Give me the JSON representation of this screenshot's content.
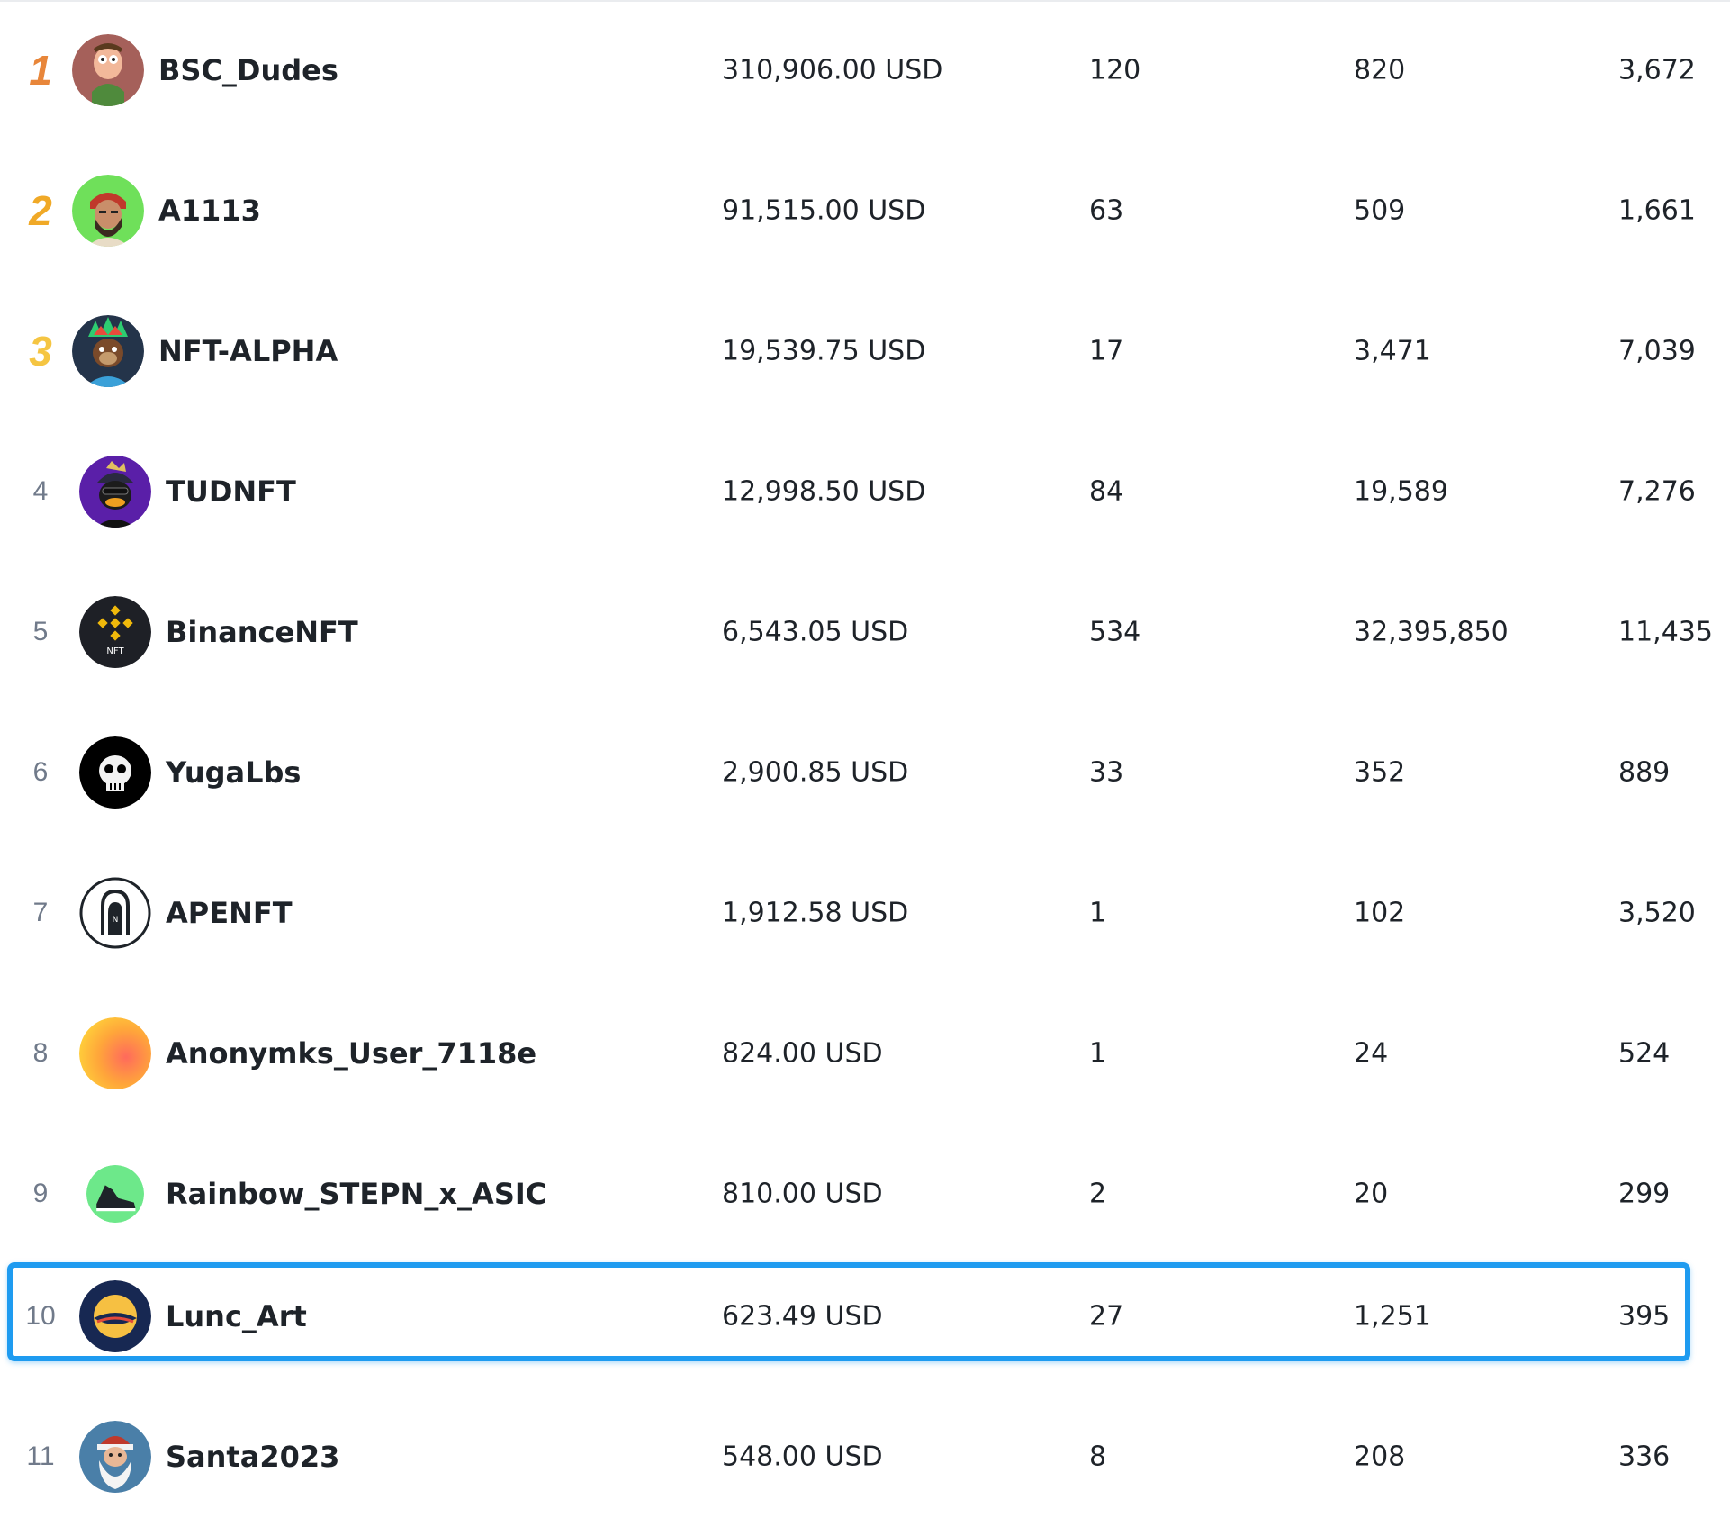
{
  "colors": {
    "rank1": "#e8863a",
    "rank2": "#f0a927",
    "rank3": "#f5c542",
    "highlight": "#1e9bf0",
    "text": "#1e2329",
    "muted": "#707a8a"
  },
  "rows": [
    {
      "rank": "1",
      "name": "BSC_Dudes",
      "volume": "310,906.00 USD",
      "sales": "120",
      "items": "820",
      "owners": "3,672",
      "avatar_icon": "cartoon-dude-avatar-icon"
    },
    {
      "rank": "2",
      "name": "A1113",
      "volume": "91,515.00 USD",
      "sales": "63",
      "items": "509",
      "owners": "1,661",
      "avatar_icon": "bearded-character-avatar-icon"
    },
    {
      "rank": "3",
      "name": "NFT-ALPHA",
      "volume": "19,539.75 USD",
      "sales": "17",
      "items": "3,471",
      "owners": "7,039",
      "avatar_icon": "ape-with-headdress-avatar-icon"
    },
    {
      "rank": "4",
      "name": "TUDNFT",
      "volume": "12,998.50 USD",
      "sales": "84",
      "items": "19,589",
      "owners": "7,276",
      "avatar_icon": "duck-with-cap-avatar-icon"
    },
    {
      "rank": "5",
      "name": "BinanceNFT",
      "volume": "6,543.05 USD",
      "sales": "534",
      "items": "32,395,850",
      "owners": "11,435",
      "avatar_icon": "binance-nft-logo-icon"
    },
    {
      "rank": "6",
      "name": "YugaLbs",
      "volume": "2,900.85 USD",
      "sales": "33",
      "items": "352",
      "owners": "889",
      "avatar_icon": "ape-skull-logo-icon"
    },
    {
      "rank": "7",
      "name": "APENFT",
      "volume": "1,912.58 USD",
      "sales": "1",
      "items": "102",
      "owners": "3,520",
      "avatar_icon": "apenft-logo-icon"
    },
    {
      "rank": "8",
      "name": "Anonymks_User_7118e",
      "volume": "824.00 USD",
      "sales": "1",
      "items": "24",
      "owners": "524",
      "avatar_icon": "gradient-avatar-icon"
    },
    {
      "rank": "9",
      "name": "Rainbow_STEPN_x_ASIC",
      "volume": "810.00 USD",
      "sales": "2",
      "items": "20",
      "owners": "299",
      "avatar_icon": "sneaker-avatar-icon"
    },
    {
      "rank": "10",
      "name": "Lunc_Art",
      "volume": "623.49 USD",
      "sales": "27",
      "items": "1,251",
      "owners": "395",
      "avatar_icon": "terra-luna-logo-icon"
    },
    {
      "rank": "11",
      "name": "Santa2023",
      "volume": "548.00 USD",
      "sales": "8",
      "items": "208",
      "owners": "336",
      "avatar_icon": "santa-avatar-icon"
    }
  ]
}
